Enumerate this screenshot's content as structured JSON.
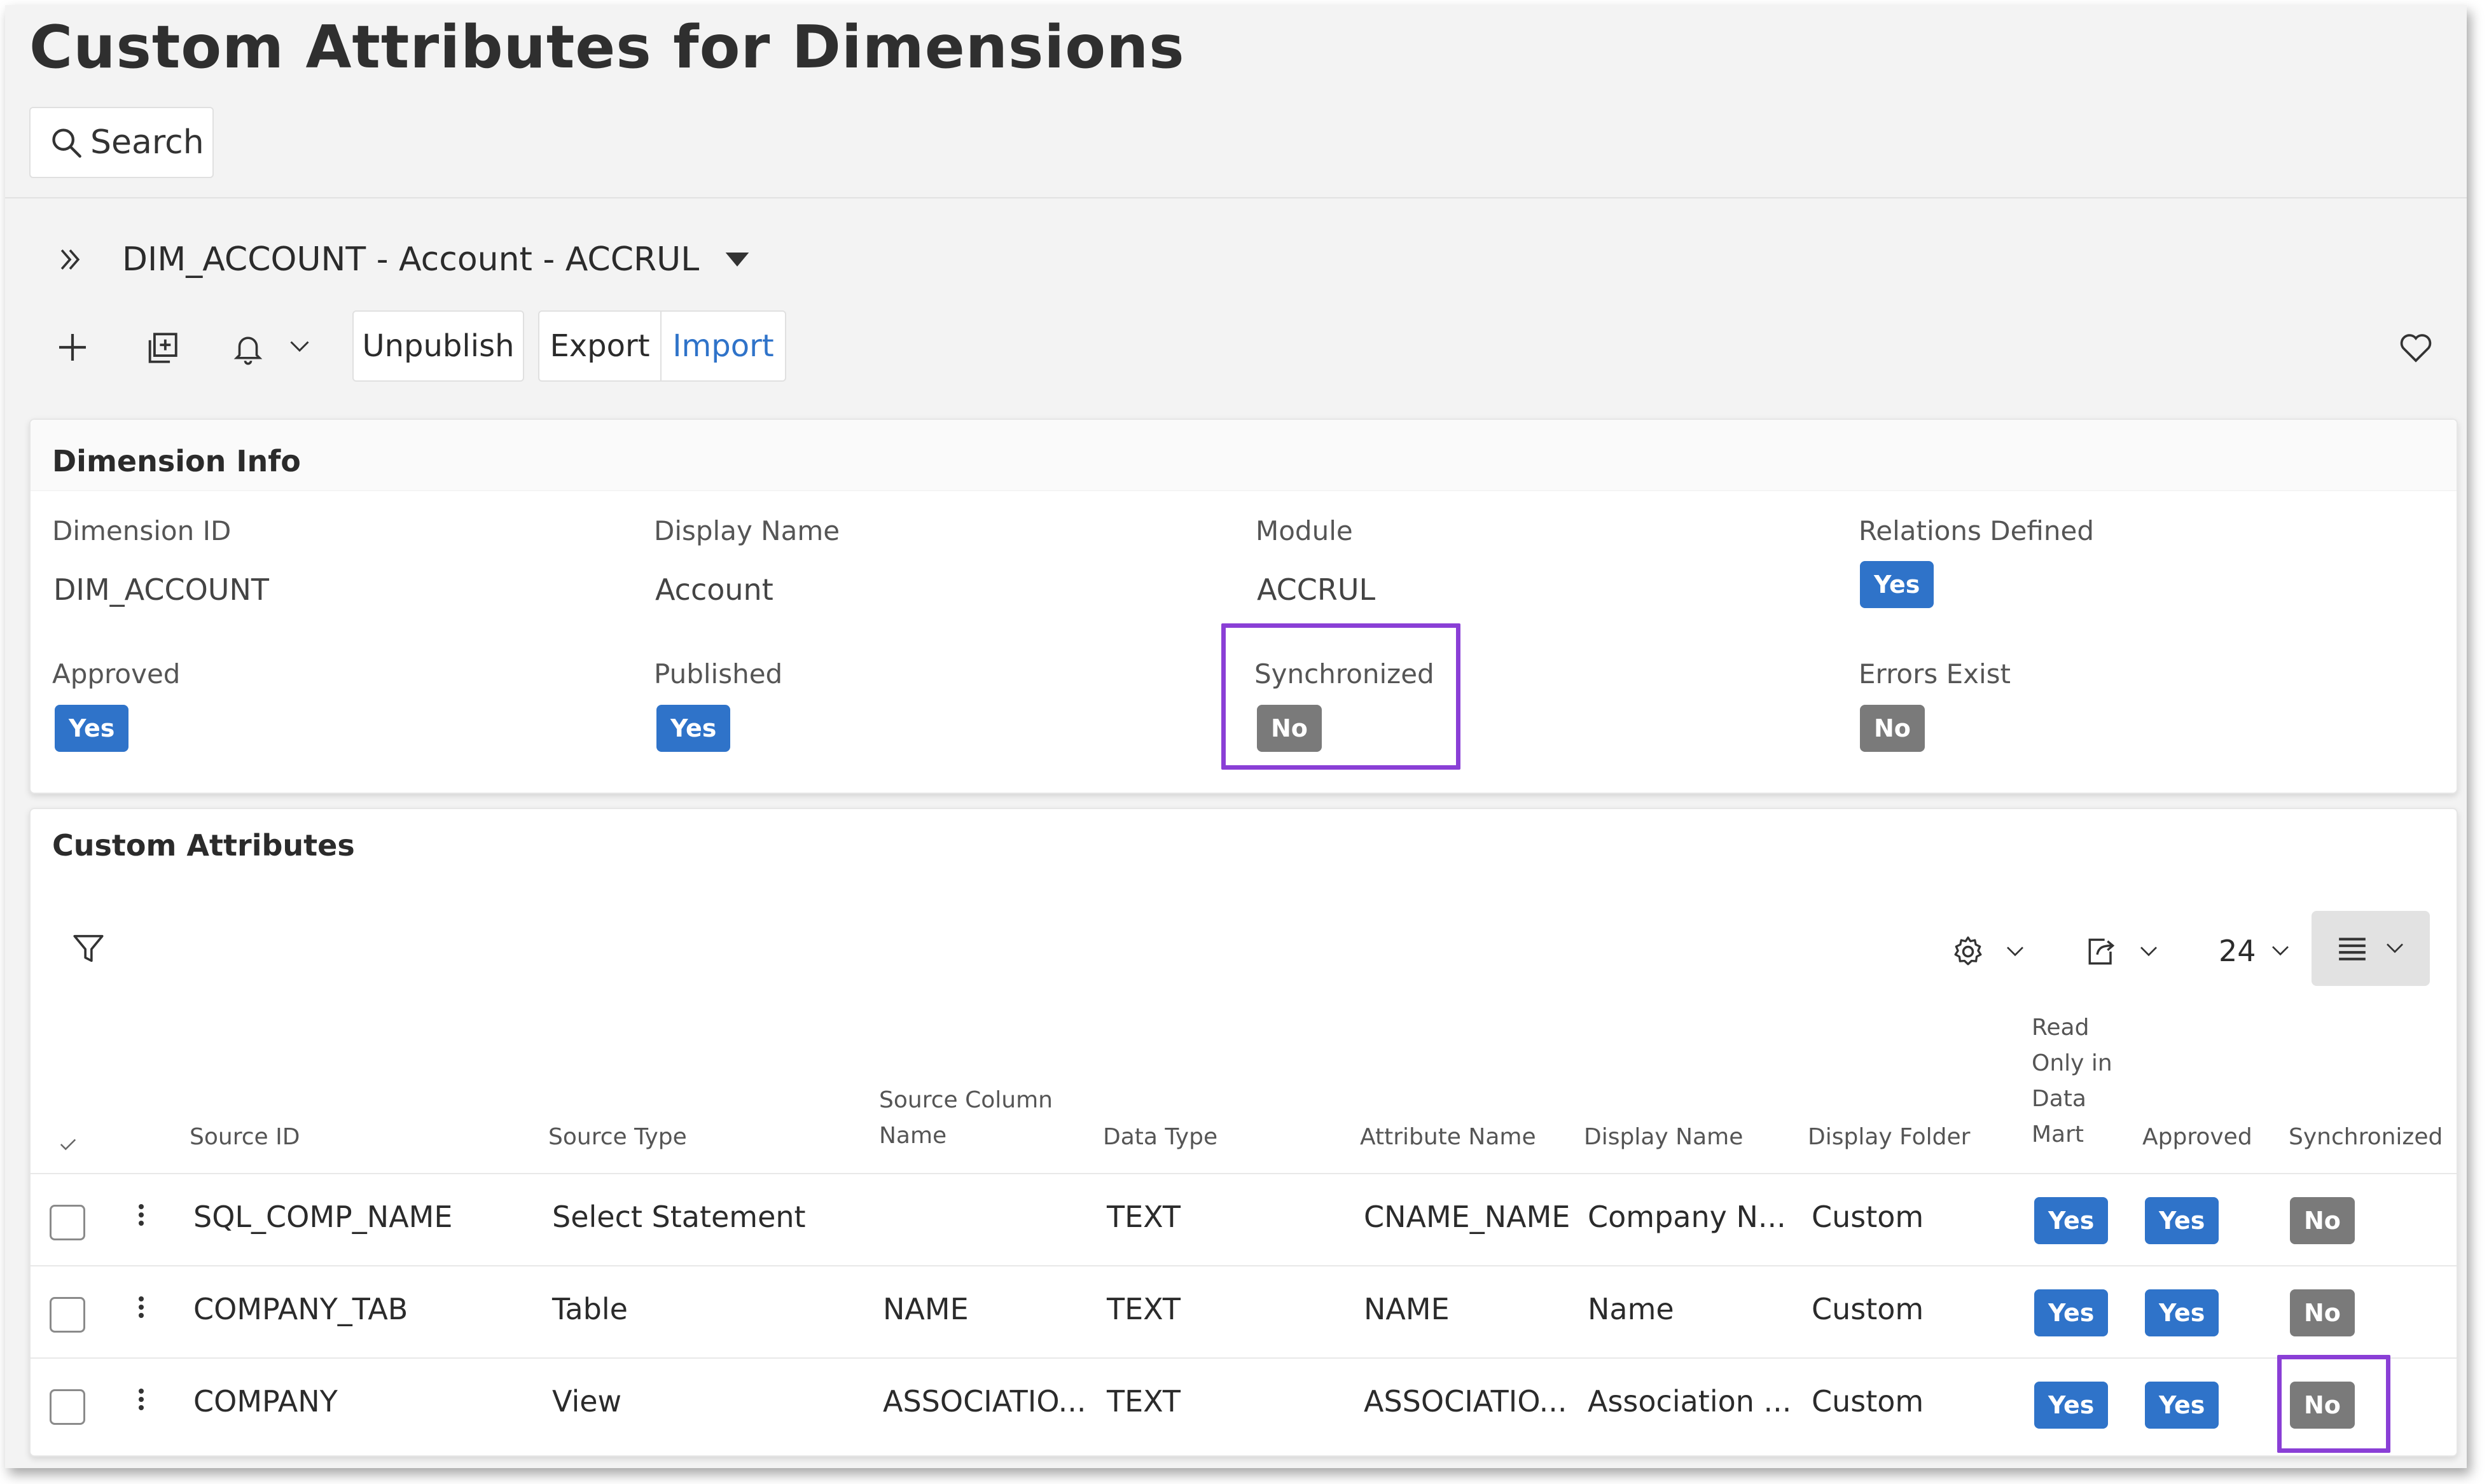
{
  "page": {
    "title": "Custom Attributes for Dimensions",
    "search_label": "Search"
  },
  "record": {
    "label": "DIM_ACCOUNT - Account - ACCRUL"
  },
  "toolbar": {
    "unpublish": "Unpublish",
    "export": "Export",
    "import": "Import"
  },
  "dimension_info": {
    "title": "Dimension Info",
    "dimension_id_label": "Dimension ID",
    "dimension_id": "DIM_ACCOUNT",
    "display_name_label": "Display Name",
    "display_name": "Account",
    "module_label": "Module",
    "module": "ACCRUL",
    "relations_defined_label": "Relations Defined",
    "relations_defined": "Yes",
    "approved_label": "Approved",
    "approved": "Yes",
    "published_label": "Published",
    "published": "Yes",
    "synchronized_label": "Synchronized",
    "synchronized": "No",
    "errors_exist_label": "Errors Exist",
    "errors_exist": "No"
  },
  "custom_attributes": {
    "title": "Custom Attributes",
    "page_size": "24",
    "columns": {
      "source_id": "Source ID",
      "source_type": "Source Type",
      "source_column_name_1": "Source Column",
      "source_column_name_2": "Name",
      "data_type": "Data Type",
      "attribute_name": "Attribute Name",
      "display_name": "Display Name",
      "display_folder": "Display Folder",
      "read_only_1": "Read",
      "read_only_2": "Only in",
      "read_only_3": "Data",
      "read_only_4": "Mart",
      "approved": "Approved",
      "synchronized": "Synchronized"
    },
    "rows": [
      {
        "source_id": "SQL_COMP_NAME",
        "source_type": "Select Statement",
        "source_column_name": "",
        "data_type": "TEXT",
        "attribute_name": "CNAME_NAME",
        "display_name": "Company N...",
        "display_folder": "Custom",
        "read_only": "Yes",
        "approved": "Yes",
        "synchronized": "No"
      },
      {
        "source_id": "COMPANY_TAB",
        "source_type": "Table",
        "source_column_name": "NAME",
        "data_type": "TEXT",
        "attribute_name": "NAME",
        "display_name": "Name",
        "display_folder": "Custom",
        "read_only": "Yes",
        "approved": "Yes",
        "synchronized": "No"
      },
      {
        "source_id": "COMPANY",
        "source_type": "View",
        "source_column_name": "ASSOCIATIO...",
        "data_type": "TEXT",
        "attribute_name": "ASSOCIATIO...",
        "display_name": "Association ...",
        "display_folder": "Custom",
        "read_only": "Yes",
        "approved": "Yes",
        "synchronized": "No"
      }
    ]
  },
  "colors": {
    "accent_blue": "#2f73c9",
    "badge_gray": "#7a7a7a",
    "highlight_purple": "#8a3fd6",
    "link_blue": "#2f73c9"
  },
  "icons": [
    "search-icon",
    "double-chevron-right-icon",
    "caret-down-icon",
    "plus-icon",
    "duplicate-icon",
    "bell-icon",
    "chevron-down-icon",
    "heart-icon",
    "filter-icon",
    "gear-icon",
    "export-icon",
    "list-density-icon",
    "checkmark-icon",
    "kebab-menu-icon"
  ]
}
